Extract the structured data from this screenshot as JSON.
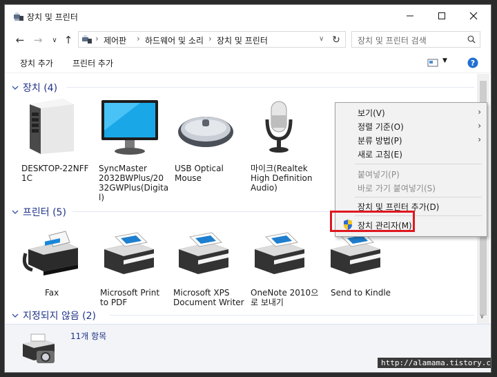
{
  "window": {
    "title": "장치 및 프린터"
  },
  "address": {
    "crumbs": [
      "제어판",
      "하드웨어 및 소리",
      "장치 및 프린터"
    ],
    "search_placeholder": "장치 및 프린터 검색"
  },
  "commands": {
    "add_device": "장치 추가",
    "add_printer": "프린터 추가"
  },
  "groups": {
    "devices": "장치 (4)",
    "printers": "프린터 (5)",
    "unspecified": "지정되지 않음 (2)"
  },
  "devices": [
    {
      "label": "DESKTOP-22NFF\n1C",
      "icon": "desktop-pc-icon"
    },
    {
      "label": "SyncMaster\n2032BWPlus/20\n32GWPlus(Digita\nl)",
      "icon": "monitor-icon"
    },
    {
      "label": "USB Optical\nMouse",
      "icon": "mouse-icon"
    },
    {
      "label": "마이크(Realtek\nHigh Definition\nAudio)",
      "icon": "microphone-icon"
    }
  ],
  "printers": [
    {
      "label": "Fax",
      "icon": "fax-icon"
    },
    {
      "label": "Microsoft Print\nto PDF",
      "icon": "printer-icon"
    },
    {
      "label": "Microsoft XPS\nDocument Writer",
      "icon": "printer-icon"
    },
    {
      "label": "OneNote 2010으\n로 보내기",
      "icon": "printer-icon"
    },
    {
      "label": "Send to Kindle",
      "icon": "printer-icon"
    }
  ],
  "status": {
    "count": "11개 항목"
  },
  "watermark": "http://alamama.tistory.com",
  "context_menu": {
    "view": "보기(V)",
    "sort_by": "정렬 기준(O)",
    "group_by": "분류 방법(P)",
    "refresh": "새로 고침(E)",
    "paste": "붙여넣기(P)",
    "paste_shortcut": "바로 가기 붙여넣기(S)",
    "add_devices_printers": "장치 및 프린터 추가(D)",
    "device_manager": "장치 관리자(M)"
  },
  "colors": {
    "group_text": "#1e3287",
    "highlight": "#e0161f"
  }
}
